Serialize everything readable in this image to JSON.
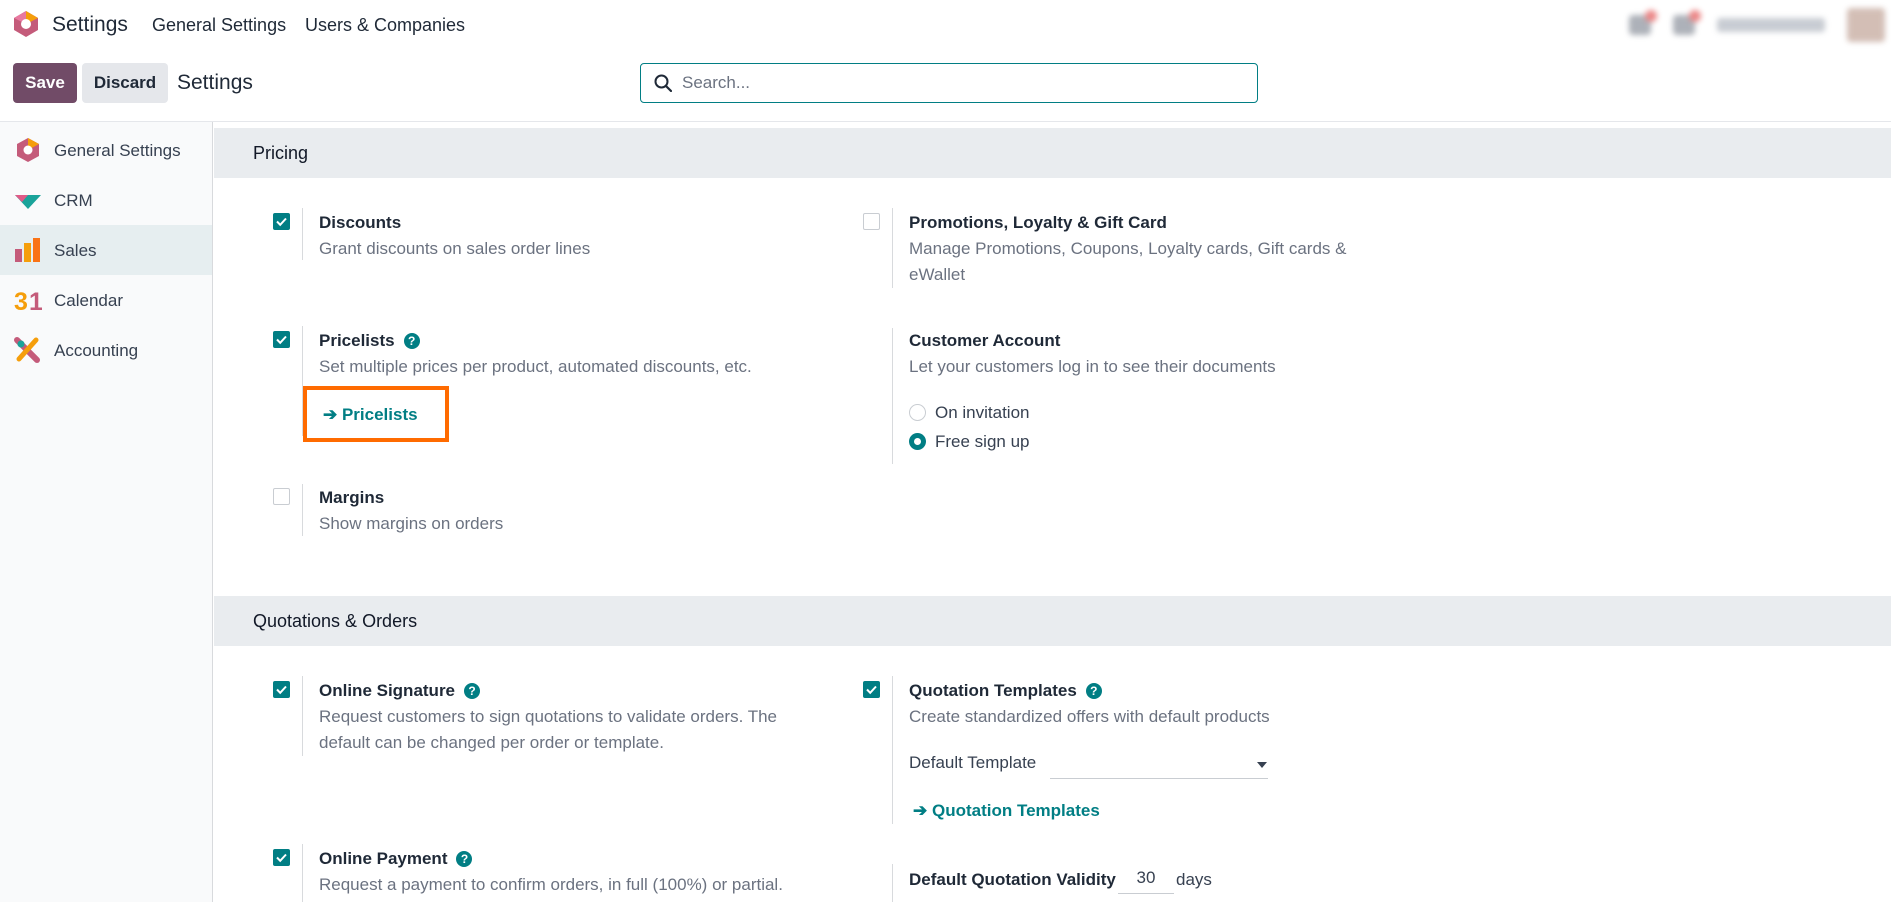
{
  "topnav": {
    "app_name": "Settings",
    "menu": [
      "General Settings",
      "Users & Companies"
    ],
    "icons": [
      "megaphone-icon",
      "chat-icon"
    ]
  },
  "control_panel": {
    "save_label": "Save",
    "discard_label": "Discard",
    "breadcrumb": "Settings",
    "search_placeholder": "Search..."
  },
  "sidebar": {
    "items": [
      {
        "label": "General Settings",
        "icon": "general-settings-icon",
        "active": false
      },
      {
        "label": "CRM",
        "icon": "crm-icon",
        "active": false
      },
      {
        "label": "Sales",
        "icon": "sales-icon",
        "active": true
      },
      {
        "label": "Calendar",
        "icon": "calendar-icon",
        "active": false
      },
      {
        "label": "Accounting",
        "icon": "accounting-icon",
        "active": false
      }
    ]
  },
  "sections": {
    "pricing": {
      "title": "Pricing",
      "discounts": {
        "title": "Discounts",
        "desc": "Grant discounts on sales order lines",
        "checked": true
      },
      "promotions": {
        "title": "Promotions, Loyalty & Gift Card",
        "desc": "Manage Promotions, Coupons, Loyalty cards, Gift cards & eWallet",
        "checked": false
      },
      "pricelists": {
        "title": "Pricelists",
        "desc": "Set multiple prices per product, automated discounts, etc.",
        "link": "Pricelists",
        "checked": true
      },
      "customer_account": {
        "title": "Customer Account",
        "desc": "Let your customers log in to see their documents",
        "options": [
          "On invitation",
          "Free sign up"
        ],
        "selected": "Free sign up"
      },
      "margins": {
        "title": "Margins",
        "desc": "Show margins on orders",
        "checked": false
      }
    },
    "quotations": {
      "title": "Quotations & Orders",
      "online_signature": {
        "title": "Online Signature",
        "desc": "Request customers to sign quotations to validate orders. The default can be changed per order or template.",
        "checked": true
      },
      "quotation_templates": {
        "title": "Quotation Templates",
        "desc": "Create standardized offers with default products",
        "field_label": "Default Template",
        "field_value": "",
        "link": "Quotation Templates",
        "checked": true
      },
      "online_payment": {
        "title": "Online Payment",
        "desc": "Request a payment to confirm orders, in full (100%) or partial.",
        "checked": true
      },
      "default_validity": {
        "title": "Default Quotation Validity",
        "value": "30",
        "unit": "days"
      }
    }
  },
  "colors": {
    "accent": "#017e84",
    "brand": "#714b67",
    "highlight": "#ff6b00"
  }
}
